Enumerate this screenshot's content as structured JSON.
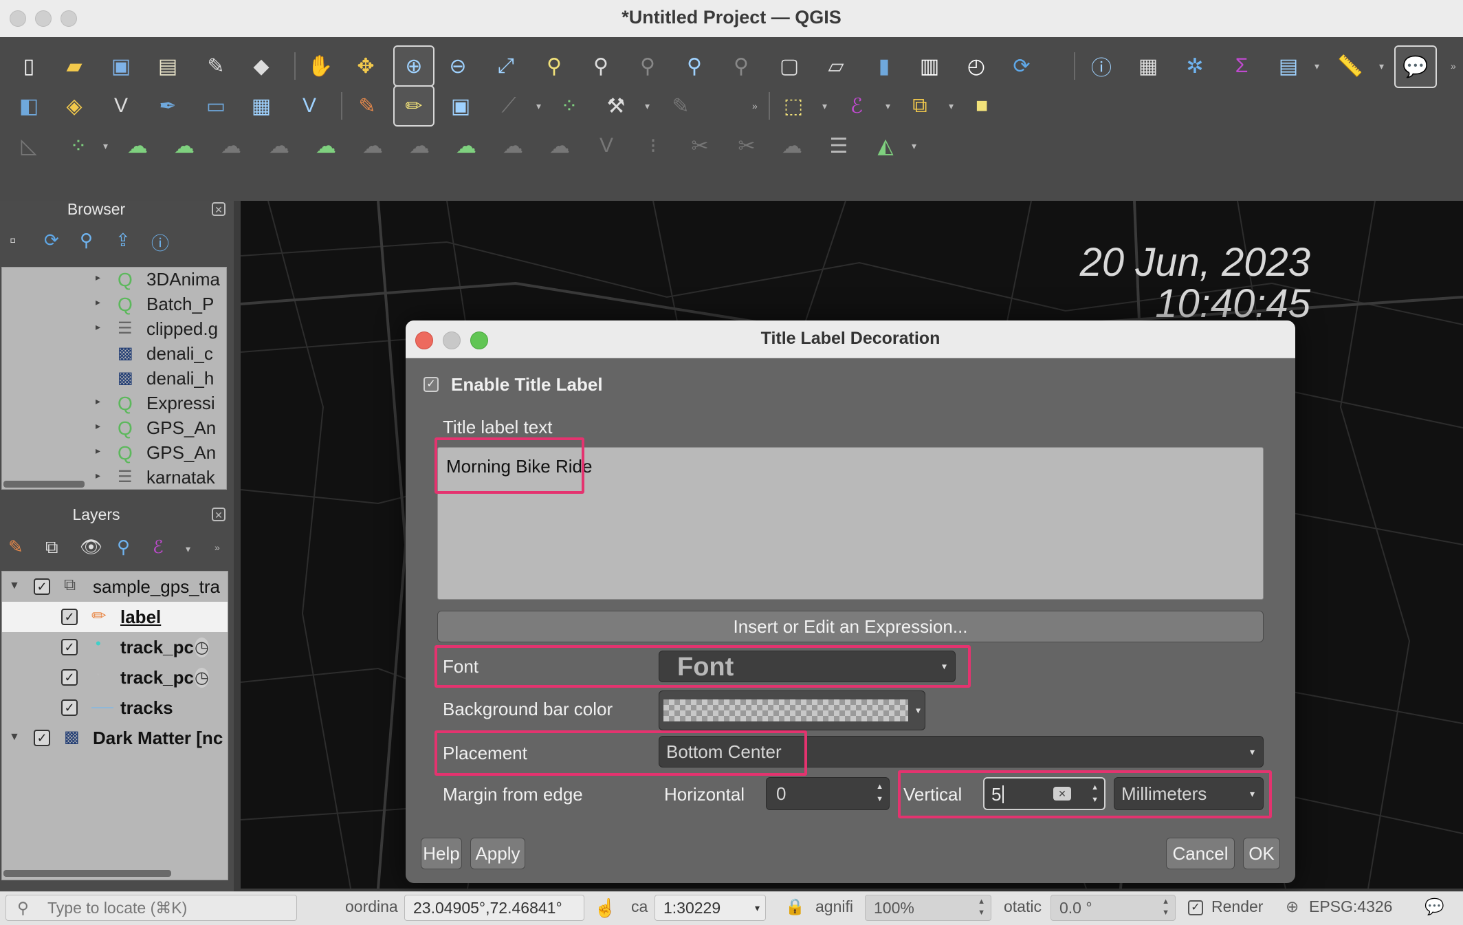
{
  "window": {
    "title": "*Untitled Project — QGIS"
  },
  "browser": {
    "title": "Browser",
    "items": [
      {
        "label": "3DAnima",
        "icon": "qgis-project-icon"
      },
      {
        "label": "Batch_P",
        "icon": "qgis-project-icon"
      },
      {
        "label": "clipped.g",
        "icon": "database-icon"
      },
      {
        "label": "denali_c",
        "icon": "raster-icon"
      },
      {
        "label": "denali_h",
        "icon": "raster-icon"
      },
      {
        "label": "Expressi",
        "icon": "qgis-project-icon"
      },
      {
        "label": "GPS_An",
        "icon": "qgis-project-icon"
      },
      {
        "label": "GPS_An",
        "icon": "qgis-project-icon"
      },
      {
        "label": "karnatak",
        "icon": "database-icon"
      }
    ]
  },
  "layers": {
    "title": "Layers",
    "items": [
      {
        "label": "sample_gps_tra",
        "icon": "group-icon",
        "checked": true,
        "level": 0
      },
      {
        "label": "label",
        "icon": "pencil-icon",
        "checked": true,
        "level": 1
      },
      {
        "label": "track_pc",
        "icon": "point-icon",
        "checked": true,
        "level": 1
      },
      {
        "label": "track_pc",
        "icon": "point-icon",
        "checked": true,
        "level": 1
      },
      {
        "label": "tracks",
        "icon": "line-icon",
        "checked": true,
        "level": 1
      },
      {
        "label": "Dark Matter [nc",
        "icon": "raster-icon",
        "checked": true,
        "level": 0
      }
    ]
  },
  "map": {
    "date_line1": "20 Jun, 2023",
    "date_line2": "10:40:45"
  },
  "dialog": {
    "title": "Title Label Decoration",
    "enable_label": "Enable Title Label",
    "text_label": "Title label text",
    "text_value": "Morning Bike Ride",
    "expression_button": "Insert or Edit an Expression...",
    "font_label": "Font",
    "font_button": "Font",
    "bg_label": "Background bar color",
    "placement_label": "Placement",
    "placement_value": "Bottom Center",
    "margin_label": "Margin from edge",
    "horizontal_label": "Horizontal",
    "horizontal_value": "0",
    "vertical_label": "Vertical",
    "vertical_value": "5",
    "units_value": "Millimeters",
    "help": "Help",
    "apply": "Apply",
    "cancel": "Cancel",
    "ok": "OK",
    "highlight_color": "#e4336f"
  },
  "status": {
    "locate_placeholder": "Type to locate (⌘K)",
    "coord_label": "oordina",
    "coord_value": "23.04905°,72.46841°",
    "scale_label": "ca",
    "scale_value": "1:30229",
    "mag_label": "agnifi",
    "mag_value": "100%",
    "rot_label": "otatic",
    "rot_value": "0.0 °",
    "render_label": "Render",
    "crs": "EPSG:4326"
  }
}
